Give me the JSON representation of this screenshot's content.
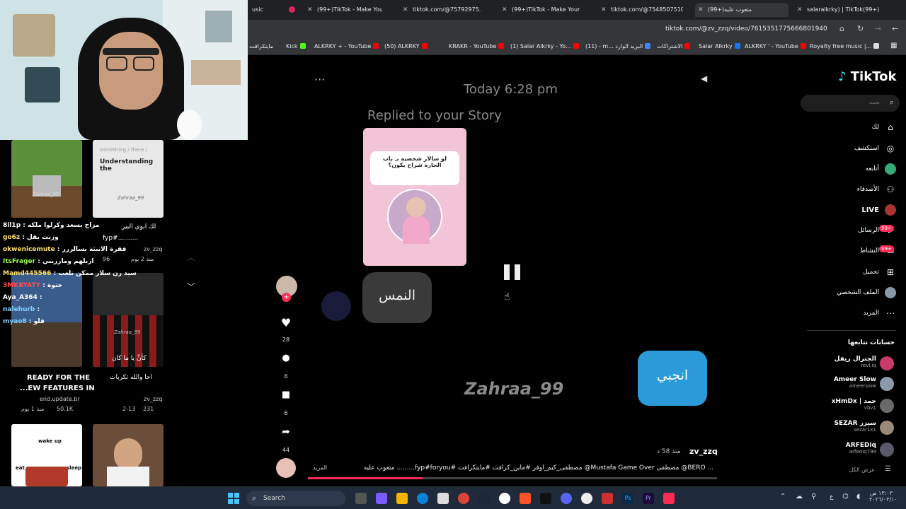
{
  "browser": {
    "tabs": [
      {
        "label": "usic",
        "active": false
      },
      {
        "label": "(99+)TikTok - Make Your",
        "active": false
      },
      {
        "label": "tiktok.com/@75792975...",
        "active": false
      },
      {
        "label": "(99+)TikTok - Make Your",
        "active": false
      },
      {
        "label": "tiktok.com/@7548507510",
        "active": false
      },
      {
        "label": "(99+)متعوب عليه",
        "active": true
      },
      {
        "label": "salaralkrky) | TikTok(99+)",
        "active": false
      }
    ],
    "url": "tiktok.com/@zv_zzq/video/7615351775666801940",
    "bookmarks": [
      "مايتكرافت",
      "Kick",
      "ALKRKY + - YouTube",
      "(50) ALKRKY",
      "KRAKR - YouTube",
      "(1) Salar Alkrky - Yo...",
      "(11) - m... البريد الوارد",
      "الاشتراكات",
      "Salar Alkrky",
      "ALKRKY ' - YouTube",
      "Royalty free music |..."
    ]
  },
  "left": {
    "chat": [
      {
        "user": "8il1p",
        "msg": "مزاح يسعد وكرلوا ملكه",
        "color": "#ffffff"
      },
      {
        "user": "go6z",
        "msg": "وزنت يقل",
        "color": "#ffe066"
      },
      {
        "user": "okwenicemute",
        "msg": "فقرة الانبثة بسالررر",
        "color": "#ffe066"
      },
      {
        "user": "ItsFrager",
        "msg": "ازبلهم ومارزيني",
        "color": "#9bff4a"
      },
      {
        "user": "Mamd445566",
        "msg": "سيد رن سلار ممكن تلعب",
        "color": "#ffe066"
      },
      {
        "user": "3MKBYATY",
        "msg": "حتوة",
        "color": "#ff4d4d"
      },
      {
        "user": "Aya_A364",
        "msg": "",
        "color": "#ffffff"
      },
      {
        "user": "nalehurb",
        "msg": "",
        "color": "#7fd0ff"
      },
      {
        "user": "myao8",
        "msg": "قلو",
        "color": "#7fd0ff"
      }
    ],
    "cards": [
      {
        "caption": "لك ابوي البير",
        "sub": "fyp#..........",
        "author": "zv_zzq",
        "views": "96",
        "time": "منذ 2 يوم"
      },
      {
        "caption": "READY FOR THE",
        "caption2": "...EW FEATURES IN",
        "author": "end.update.br",
        "views": "50.1K",
        "time": "منذ 1 يوم"
      },
      {
        "caption": "احا والله تكريات",
        "caption2": "كأنَّ يا ما كان",
        "author": "zv_zzq",
        "views": "231",
        "time": "2-13"
      }
    ],
    "thumb_text": [
      "Zahraa_99",
      "Understanding the",
      "something / there /",
      "wake up",
      "sleep",
      "eat"
    ]
  },
  "video": {
    "time_header": "Today 6:28 pm",
    "replied": "Replied to your Story",
    "story_text": "لو سالار شخصيه بـ باب الحاره شراح يكون؟",
    "reply_bubble": "النمس",
    "my_bubble": "انجبي",
    "watermark": "Zahraa_99",
    "author": "zv_zzq",
    "posted": "منذ 58 د",
    "description": "متعوب عليه .........fyp#foryou# مصطفى_كيم_اوفر #ماين_كرافت #ماينكرافت @Mustafa Game Over مصطفى @BERO ...",
    "more": "المزيد"
  },
  "actions": {
    "likes": "28",
    "comments": "6",
    "saves": "6",
    "shares": "44"
  },
  "sidebar": {
    "logo": "TikTok",
    "search_placeholder": "بحث",
    "nav": [
      {
        "label": "لك",
        "icon": "home-icon"
      },
      {
        "label": "استكشف",
        "icon": "compass-icon"
      },
      {
        "label": "أتابعه",
        "icon": "following-icon"
      },
      {
        "label": "الأصدقاء",
        "icon": "friends-icon"
      },
      {
        "label": "LIVE",
        "icon": "live-icon"
      },
      {
        "label": "الرسائل",
        "icon": "messages-icon",
        "badge": "99+"
      },
      {
        "label": "النشاط",
        "icon": "activity-icon",
        "badge": "99+"
      },
      {
        "label": "تحميل",
        "icon": "upload-icon"
      },
      {
        "label": "الملف الشخصي",
        "icon": "profile-icon"
      },
      {
        "label": "المزيد",
        "icon": "more-icon"
      }
    ],
    "following_title": "حسابات تتابعها",
    "accounts": [
      {
        "name": "الجنرال ريفل",
        "handle": "revl.iq"
      },
      {
        "name": "Ameer Slow",
        "handle": "ameerslow"
      },
      {
        "name": "xHmDx | حمد",
        "handle": "vbv1"
      },
      {
        "name": "SEZAR سيزر",
        "handle": "sezar1x1"
      },
      {
        "name": "ARFEDiq",
        "handle": "arfediq799"
      }
    ],
    "see_all": "عرض الكل"
  },
  "taskbar": {
    "search": "Search",
    "clock_time": "١٣:٠٣ ص",
    "clock_date": "٢٠٢٦/٠٣/١٠",
    "lang": "ع"
  }
}
